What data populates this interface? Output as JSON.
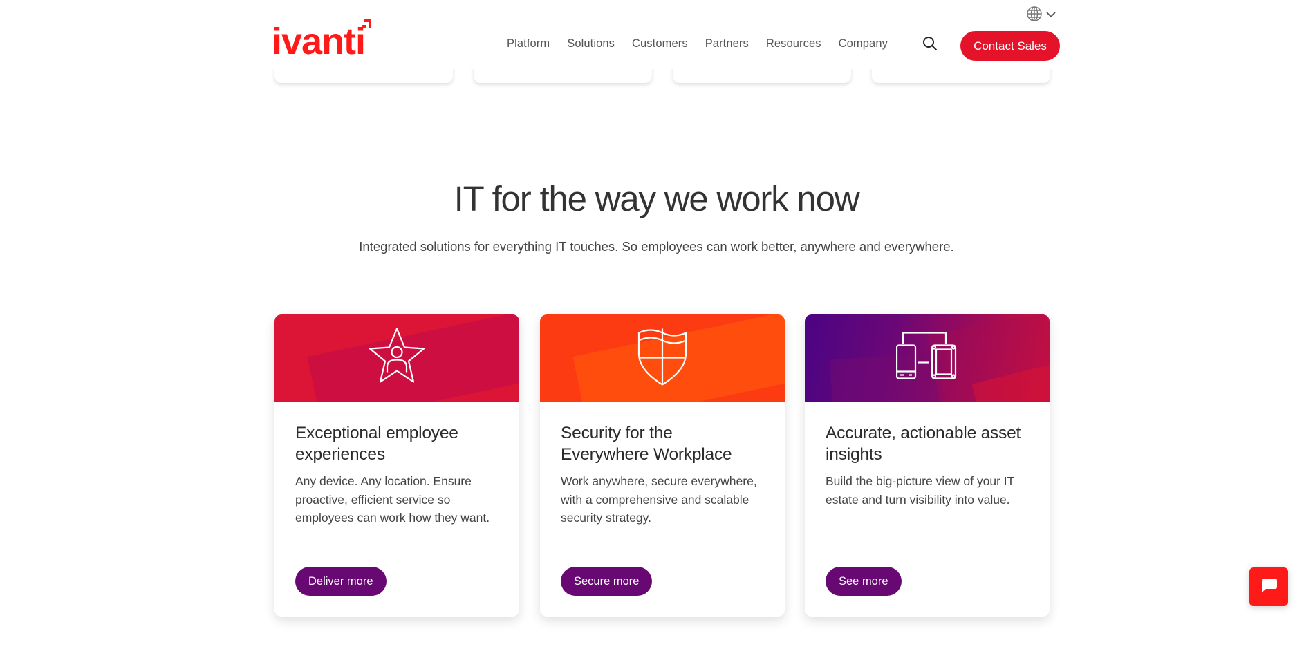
{
  "brand": {
    "logo_text": "ivanti",
    "color": "#ff1a1a"
  },
  "header": {
    "language_selector_icon": "globe-icon",
    "nav": [
      {
        "label": "Platform"
      },
      {
        "label": "Solutions"
      },
      {
        "label": "Customers"
      },
      {
        "label": "Partners"
      },
      {
        "label": "Resources"
      },
      {
        "label": "Company"
      }
    ],
    "search_icon": "search-icon",
    "cta_label": "Contact Sales",
    "cta_color": "#e5132a"
  },
  "hero": {
    "title": "IT for the way we work now",
    "subtitle": "Integrated solutions for everything IT touches. So employees can work better, anywhere and everywhere."
  },
  "cards": [
    {
      "icon": "star-person-icon",
      "title": "Exceptional employee experiences",
      "text": "Any device. Any location. Ensure proactive, efficient service so employees can work how they want.",
      "button": "Deliver more",
      "colors": [
        "#dc1436",
        "#cc0f40"
      ]
    },
    {
      "icon": "shield-icon",
      "title": "Security for the Everywhere Workplace",
      "text": "Work anywhere, secure everywhere, with a comprehensive and scalable security strategy.",
      "button": "Secure more",
      "colors": [
        "#fd3b12",
        "#ff4d0d"
      ]
    },
    {
      "icon": "devices-icon",
      "title": "Accurate, actionable asset insights",
      "text": "Build the big-picture view of your IT estate and turn visibility into value.",
      "button": "See more",
      "colors": [
        "#4b0484",
        "#d0123a"
      ]
    }
  ],
  "button_color": "#680873",
  "chat": {
    "icon": "chat-bubble-icon"
  }
}
